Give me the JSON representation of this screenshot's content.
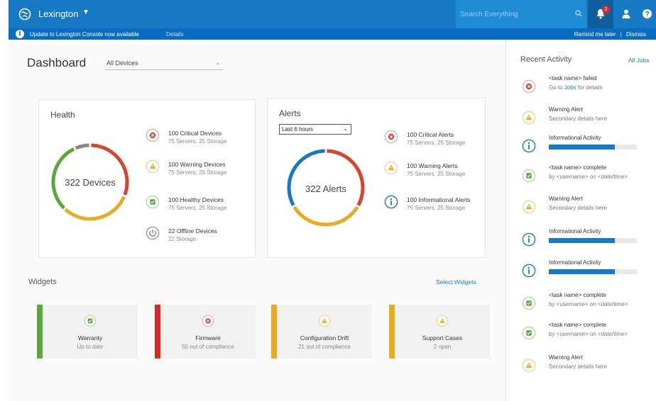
{
  "topbar": {
    "brand": "Lexington",
    "search_placeholder": "Search Everything",
    "alerts_count": "2"
  },
  "notice": {
    "text": "Update to Lexington Console now available",
    "details": "Details",
    "remind": "Remind me later",
    "separator": "|",
    "dismiss": "Dismiss"
  },
  "dashboard": {
    "title": "Dashboard",
    "device_filter": "All Devices"
  },
  "health": {
    "title": "Health",
    "center_label": "322 Devices",
    "segments": [
      {
        "name": "Critical",
        "value": 100,
        "color": "#d9432f"
      },
      {
        "name": "Warning",
        "value": 100,
        "color": "#e9ab22"
      },
      {
        "name": "Healthy",
        "value": 100,
        "color": "#5ba73a"
      },
      {
        "name": "Offline",
        "value": 22,
        "color": "#888888"
      }
    ],
    "items": [
      {
        "title": "100 Critical Devices",
        "sub": "75 Servers, 25 Storage",
        "icon": "critical-icon"
      },
      {
        "title": "100 Warning Devices",
        "sub": "75 Servers, 25 Storage",
        "icon": "warning-icon"
      },
      {
        "title": "100 Healthy Devices",
        "sub": "75 Servers, 25 Storage",
        "icon": "healthy-icon"
      },
      {
        "title": "22 Offline Devices",
        "sub": "22 Storage",
        "icon": "power-icon"
      }
    ]
  },
  "alerts": {
    "title": "Alerts",
    "range": "Last 6 hours",
    "center_label": "322 Alerts",
    "segments": [
      {
        "name": "Critical",
        "value": 100,
        "color": "#d9432f"
      },
      {
        "name": "Warning",
        "value": 100,
        "color": "#e9ab22"
      },
      {
        "name": "Informational",
        "value": 100,
        "color": "#1779c4"
      }
    ],
    "items": [
      {
        "title": "100 Critical Alerts",
        "sub": "75 Servers, 25 Storage",
        "icon": "critical-icon"
      },
      {
        "title": "100 Warning Alerts",
        "sub": "75 Servers, 25 Storage",
        "icon": "warning-icon"
      },
      {
        "title": "100 Informational Alerts",
        "sub": "75 Servers, 25 Storage",
        "icon": "info-icon"
      }
    ]
  },
  "widgets": {
    "title": "Widgets",
    "select_label": "Select Widgets",
    "items": [
      {
        "title": "Warranty",
        "sub": "Up to date",
        "color": "#5ba73a",
        "icon": "healthy-icon"
      },
      {
        "title": "Firmware",
        "sub": "50 out of compliance",
        "color": "#d92a2a",
        "icon": "critical-icon"
      },
      {
        "title": "Configuration Drift",
        "sub": "21 out of compliance",
        "color": "#e9ab22",
        "icon": "warning-icon"
      },
      {
        "title": "Support Cases",
        "sub": "2 open",
        "color": "#e9ab22",
        "icon": "warning-icon"
      }
    ]
  },
  "activity": {
    "title": "Recent Activity",
    "all_jobs": "All Jobs",
    "items": [
      {
        "title": "<task name> failed",
        "sub_pre": "Go to ",
        "sub_link": "Jobs",
        "sub_post": " for details",
        "icon": "critical-icon"
      },
      {
        "title": "Warning Alert",
        "sub": "Secondary details here",
        "icon": "warning-icon"
      },
      {
        "title": "Informational Activity",
        "progress": 0.75,
        "icon": "info-icon"
      },
      {
        "title": "<task name> complete",
        "sub": "by <username> on <date/time>",
        "icon": "healthy-icon"
      },
      {
        "title": "Warning Alert",
        "sub": "Secondary details here",
        "icon": "warning-icon"
      },
      {
        "title": "Informational Activity",
        "progress": 0.75,
        "icon": "info-icon"
      },
      {
        "title": "Informational Activity",
        "progress": 0.75,
        "icon": "info-icon"
      },
      {
        "title": "<task name> complete",
        "sub": "by <username> on <date/time>",
        "icon": "healthy-icon"
      },
      {
        "title": "<task name> complete",
        "sub": "by <username> on <date/time>",
        "icon": "healthy-icon"
      },
      {
        "title": "Warning Alert",
        "sub": "Secondary details here",
        "icon": "warning-icon"
      }
    ]
  }
}
